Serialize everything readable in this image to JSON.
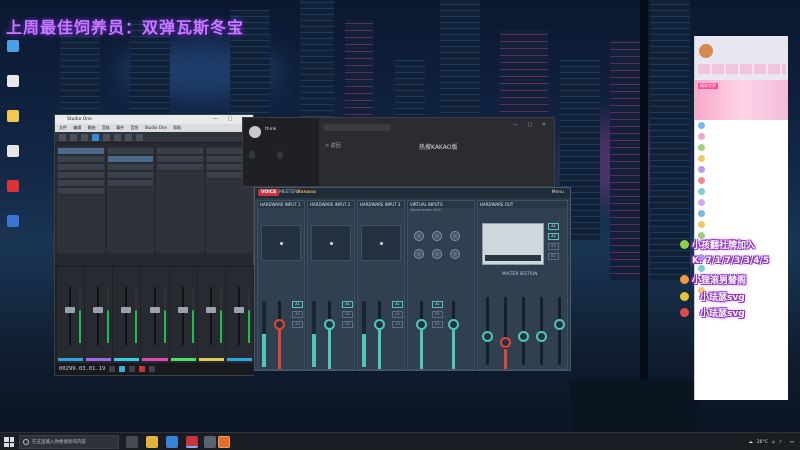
{
  "stream": {
    "banner": "上周最佳饲养员：双弹瓦斯冬宝"
  },
  "desktop": {
    "icons": [
      {
        "label": "",
        "color": "#4aa0e6"
      },
      {
        "label": "",
        "color": "#e8e8e8"
      },
      {
        "label": "",
        "color": "#f2c94c"
      },
      {
        "label": "",
        "color": "#e6e6e6"
      },
      {
        "label": "",
        "color": "#d93535"
      },
      {
        "label": "",
        "color": "#3a74d4"
      }
    ]
  },
  "daw": {
    "title": "Studio One",
    "menu": [
      "文件",
      "编辑",
      "歌曲",
      "音轨",
      "事件",
      "音频",
      "Studio One",
      "帮助"
    ],
    "timecode": "00299.03.01.19"
  },
  "music_app": {
    "user_name": "think",
    "user_sub": "",
    "back_label": "< 返回",
    "page_title": "热搜KAKAO版",
    "side_buttons": [
      "",
      ""
    ]
  },
  "voicemeeter": {
    "brand": "VOICE",
    "brand2": "MEETER",
    "edition": "Banana",
    "menu": "Menu",
    "sections": [
      {
        "title": "HARDWARE INPUT 1",
        "sub": ""
      },
      {
        "title": "HARDWARE INPUT 2",
        "sub": ""
      },
      {
        "title": "HARDWARE INPUT 3",
        "sub": ""
      },
      {
        "title": "VIRTUAL INPUTS",
        "sub": "Voicemeeter VAIO"
      },
      {
        "title": "HARDWARE OUT",
        "sub": ""
      }
    ],
    "master_label": "MASTER SECTION",
    "bus_labels": [
      "A1",
      "A2",
      "A3",
      "B1",
      "B2"
    ]
  },
  "chat": {
    "room_info": "",
    "banner_tag": "精彩世界",
    "messages": [
      {
        "text": "",
        "color": "#7ab7f0"
      },
      {
        "text": "",
        "color": "#f0a8c8"
      },
      {
        "text": "",
        "color": "#9ad17a"
      },
      {
        "text": "",
        "color": "#f4c46b"
      },
      {
        "text": "",
        "color": "#b79af2"
      },
      {
        "text": "",
        "color": "#f08a8a"
      },
      {
        "text": "",
        "color": "#7ad1c6"
      },
      {
        "text": "",
        "color": "#d5a6f5"
      },
      {
        "text": "",
        "color": "#7ab7f0"
      },
      {
        "text": "",
        "color": "#f4c46b"
      },
      {
        "text": "",
        "color": "#9ad17a"
      },
      {
        "text": "",
        "color": "#f0a8c8"
      },
      {
        "text": "",
        "color": "#b79af2"
      },
      {
        "text": "",
        "color": "#7ad1c6"
      },
      {
        "text": "",
        "color": "#f08a8a"
      },
      {
        "text": "",
        "color": "#f4c46b"
      }
    ],
    "gifts": [
      "小孩翻社牌加入",
      "K. 7/1/7/3/3/4/5",
      "小狸滚男替阁",
      "小珐瑟svg",
      "小珐瑟svg"
    ]
  },
  "watermark": "",
  "taskbar": {
    "search_placeholder": "在这里输入你要搜索的内容",
    "temperature": "26°C",
    "time": "",
    "date": ""
  }
}
